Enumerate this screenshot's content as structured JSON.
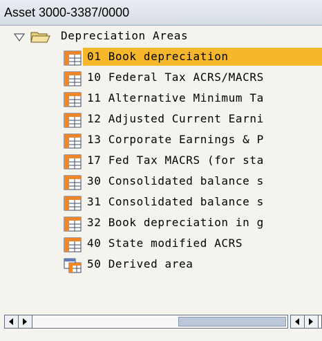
{
  "header": {
    "title": "Asset 3000-3387/0000"
  },
  "tree": {
    "root": {
      "label": "Depreciation Areas",
      "icon": "folder-open-icon",
      "expand_icon": "triangle-down-icon"
    },
    "items": [
      {
        "label": "01 Book depreciation",
        "icon": "table-icon",
        "selected": true
      },
      {
        "label": "10 Federal Tax ACRS/MACRS",
        "icon": "table-icon"
      },
      {
        "label": "11 Alternative Minimum Ta",
        "icon": "table-icon"
      },
      {
        "label": "12 Adjusted Current Earni",
        "icon": "table-icon"
      },
      {
        "label": "13 Corporate Earnings & P",
        "icon": "table-icon"
      },
      {
        "label": "17 Fed Tax MACRS (for sta",
        "icon": "table-icon"
      },
      {
        "label": "30 Consolidated balance s",
        "icon": "table-icon"
      },
      {
        "label": "31 Consolidated balance s",
        "icon": "table-icon"
      },
      {
        "label": "32 Book depreciation in g",
        "icon": "table-icon"
      },
      {
        "label": "40 State modified ACRS",
        "icon": "table-icon"
      },
      {
        "label": "50 Derived area",
        "icon": "derived-table-icon"
      }
    ]
  },
  "colors": {
    "selection": "#f6b82a",
    "background": "#f4f3ee"
  }
}
